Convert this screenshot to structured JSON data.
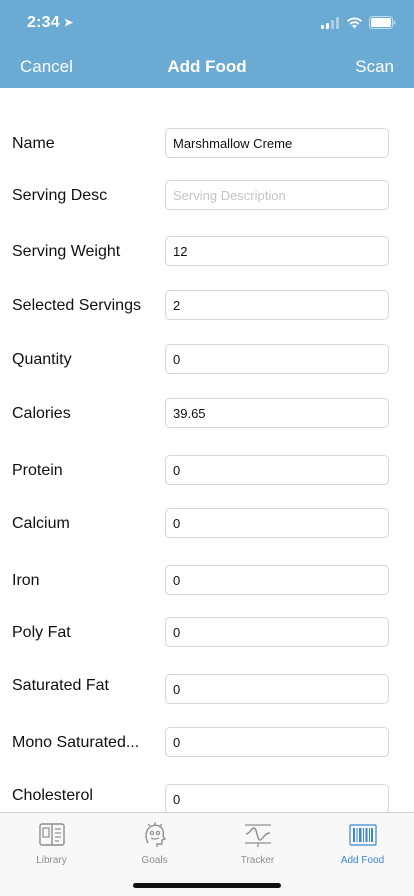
{
  "status_bar": {
    "time": "2:34",
    "location_glyph": "➤"
  },
  "nav": {
    "title": "Add Food",
    "cancel_label": "Cancel",
    "scan_label": "Scan"
  },
  "colors": {
    "header": "#6aaad3",
    "tab_active": "#3a86d6",
    "tab_inactive": "#8e8e8e"
  },
  "form": {
    "fields": [
      {
        "label": "Name",
        "value": "Marshmallow Creme",
        "placeholder": ""
      },
      {
        "label": "Serving Desc",
        "value": "",
        "placeholder": "Serving Description"
      },
      {
        "label": "Serving Weight",
        "value": "12",
        "placeholder": ""
      },
      {
        "label": "Selected Servings",
        "value": "2",
        "placeholder": ""
      },
      {
        "label": "Quantity",
        "value": "0",
        "placeholder": ""
      },
      {
        "label": "Calories",
        "value": "39.65",
        "placeholder": ""
      },
      {
        "label": "Protein",
        "value": "0",
        "placeholder": ""
      },
      {
        "label": "Calcium",
        "value": "0",
        "placeholder": ""
      },
      {
        "label": "Iron",
        "value": "0",
        "placeholder": ""
      },
      {
        "label": "Poly Fat",
        "value": "0",
        "placeholder": ""
      },
      {
        "label": "Saturated Fat",
        "value": "0",
        "placeholder": ""
      },
      {
        "label": "Mono Saturated...",
        "value": "0",
        "placeholder": ""
      },
      {
        "label": "Cholesterol",
        "value": "0",
        "placeholder": ""
      }
    ]
  },
  "tabbar": {
    "tabs": [
      {
        "label": "Library",
        "icon": "library-book-icon",
        "active": false
      },
      {
        "label": "Goals",
        "icon": "goals-head-icon",
        "active": false
      },
      {
        "label": "Tracker",
        "icon": "tracker-wave-icon",
        "active": false
      },
      {
        "label": "Add Food",
        "icon": "barcode-icon",
        "active": true
      }
    ]
  }
}
